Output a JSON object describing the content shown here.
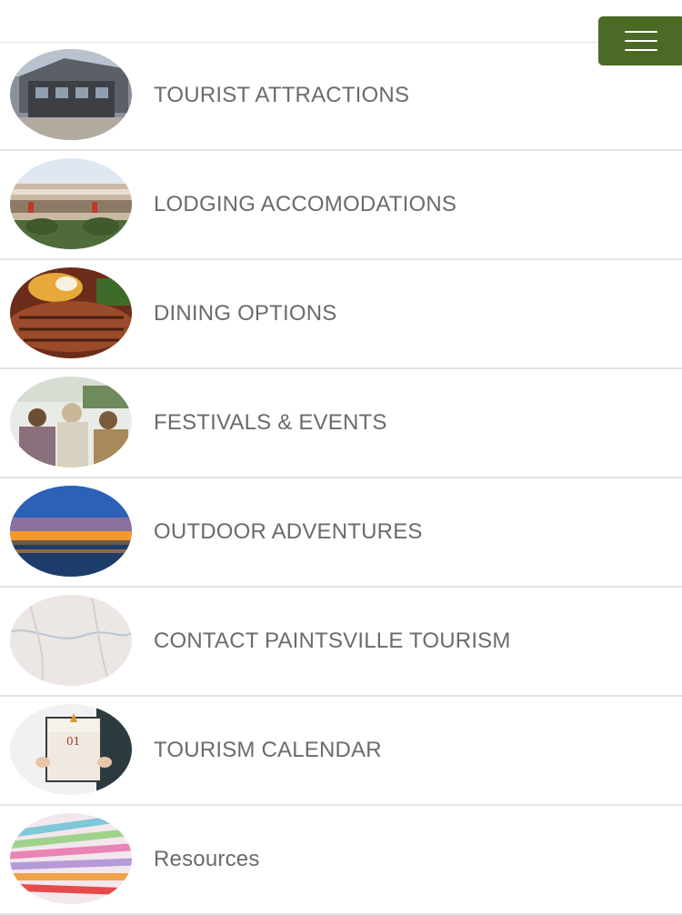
{
  "header": {
    "menu_icon": "hamburger-menu-icon",
    "accent_color": "#4a6a26"
  },
  "menu": {
    "items": [
      {
        "label": "TOURIST ATTRACTIONS",
        "image": "building-photo"
      },
      {
        "label": "LODGING ACCOMODATIONS",
        "image": "hotel-photo"
      },
      {
        "label": "DINING OPTIONS",
        "image": "steak-dinner-photo"
      },
      {
        "label": "FESTIVALS & EVENTS",
        "image": "festival-crowd-photo"
      },
      {
        "label": "OUTDOOR ADVENTURES",
        "image": "sunset-lake-photo"
      },
      {
        "label": "CONTACT PAINTSVILLE TOURISM",
        "image": "map-photo"
      },
      {
        "label": "TOURISM CALENDAR",
        "image": "calendar-photo"
      },
      {
        "label": "Resources",
        "image": "colored-papers-photo"
      }
    ]
  }
}
